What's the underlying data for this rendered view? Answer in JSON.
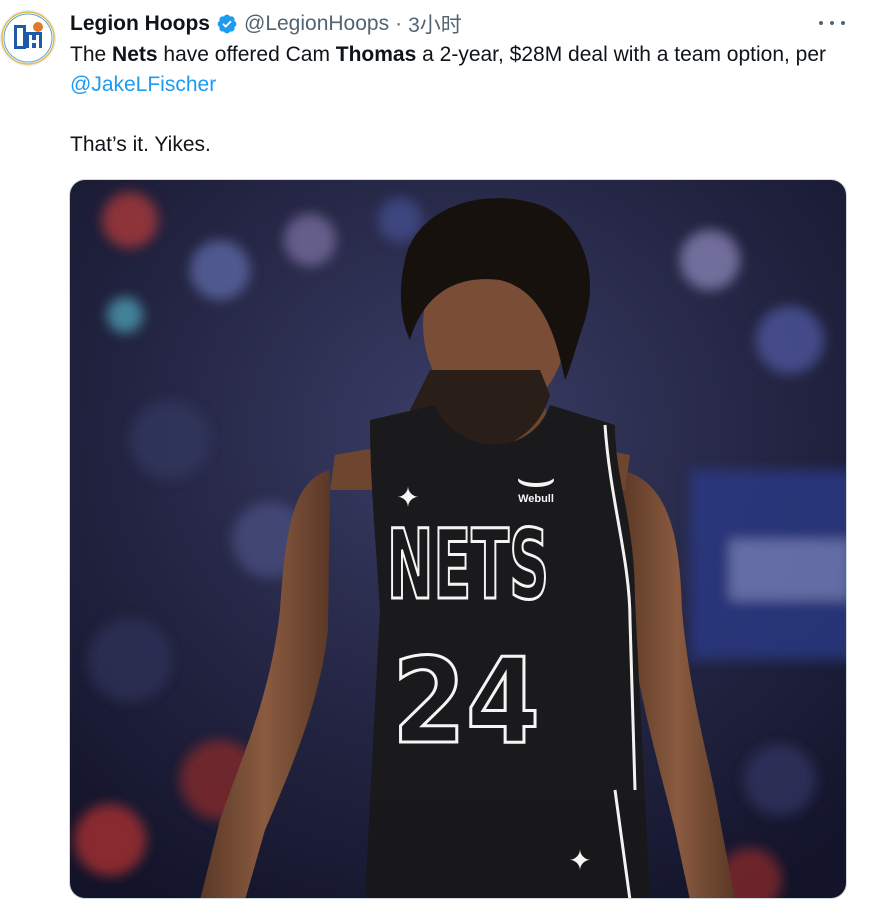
{
  "tweet": {
    "author_name": "Legion Hoops",
    "handle": "@LegionHoops",
    "separator": "·",
    "time": "3小时",
    "text_parts": {
      "p1": "The ",
      "b1": "Nets",
      "p2": " have offered Cam ",
      "b2": "Thomas",
      "p3": " a 2-year, $28M deal with a team option, per ",
      "mention": "@JakeLFischer",
      "line2": "That’s it. Yikes."
    }
  },
  "media": {
    "jersey_wordmark": "NETS",
    "jersey_number": "24",
    "sponsor_patch": "Webull"
  },
  "icons": {
    "avatar": "legion-hoops-logo",
    "verified": "verified-badge-icon",
    "more": "more-options-icon",
    "jersey_logo": "jumpman-logo"
  },
  "colors": {
    "link": "#1d9bf0",
    "verified": "#1d9bf0",
    "text": "#0f1419",
    "muted": "#536471",
    "jersey": "#1a1a1c"
  }
}
